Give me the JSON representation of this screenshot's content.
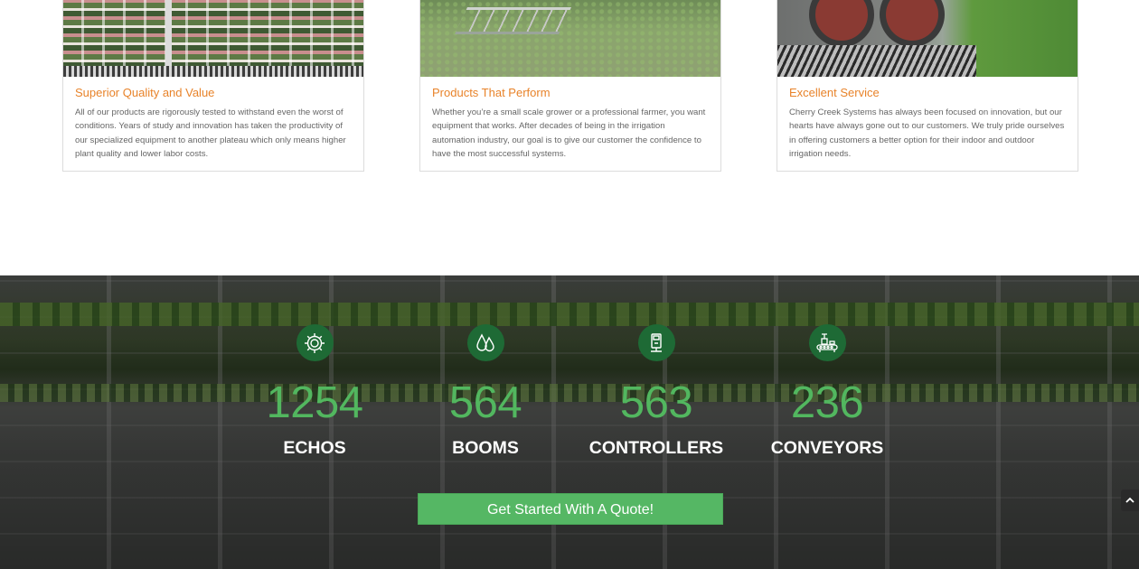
{
  "cards": [
    {
      "title": "Superior Quality and Value",
      "text": "All of our products are rigorously tested to withstand even the worst of conditions. Years of study and innovation has taken the productivity of our specialized equipment to another plateau which only means higher plant quality and lower labor costs."
    },
    {
      "title": "Products That Perform",
      "text": "Whether you’re a small scale grower or a professional farmer, you want equipment that works. After decades of being in the irrigation automation industry, our goal is to give our customer the confidence to have the most successful systems."
    },
    {
      "title": "Excellent Service",
      "text": "Cherry Creek Systems has always been focused on innovation, but our hearts have always gone out to our customers. We truly pride ourselves in offering customers a better option for their indoor and outdoor irrigation needs."
    }
  ],
  "stats": [
    {
      "icon": "gear-icon",
      "number": "1254",
      "label": "ECHOS"
    },
    {
      "icon": "water-drops-icon",
      "number": "564",
      "label": "BOOMS"
    },
    {
      "icon": "controller-icon",
      "number": "563",
      "label": "CONTROLLERS"
    },
    {
      "icon": "conveyor-icon",
      "number": "236",
      "label": "CONVEYORS"
    }
  ],
  "cta": {
    "label": "Get Started With A Quote!"
  },
  "colors": {
    "accent_orange": "#e8832a",
    "stat_green": "#52b75f",
    "icon_circle": "#1e6a35",
    "button_green": "#55b764"
  }
}
